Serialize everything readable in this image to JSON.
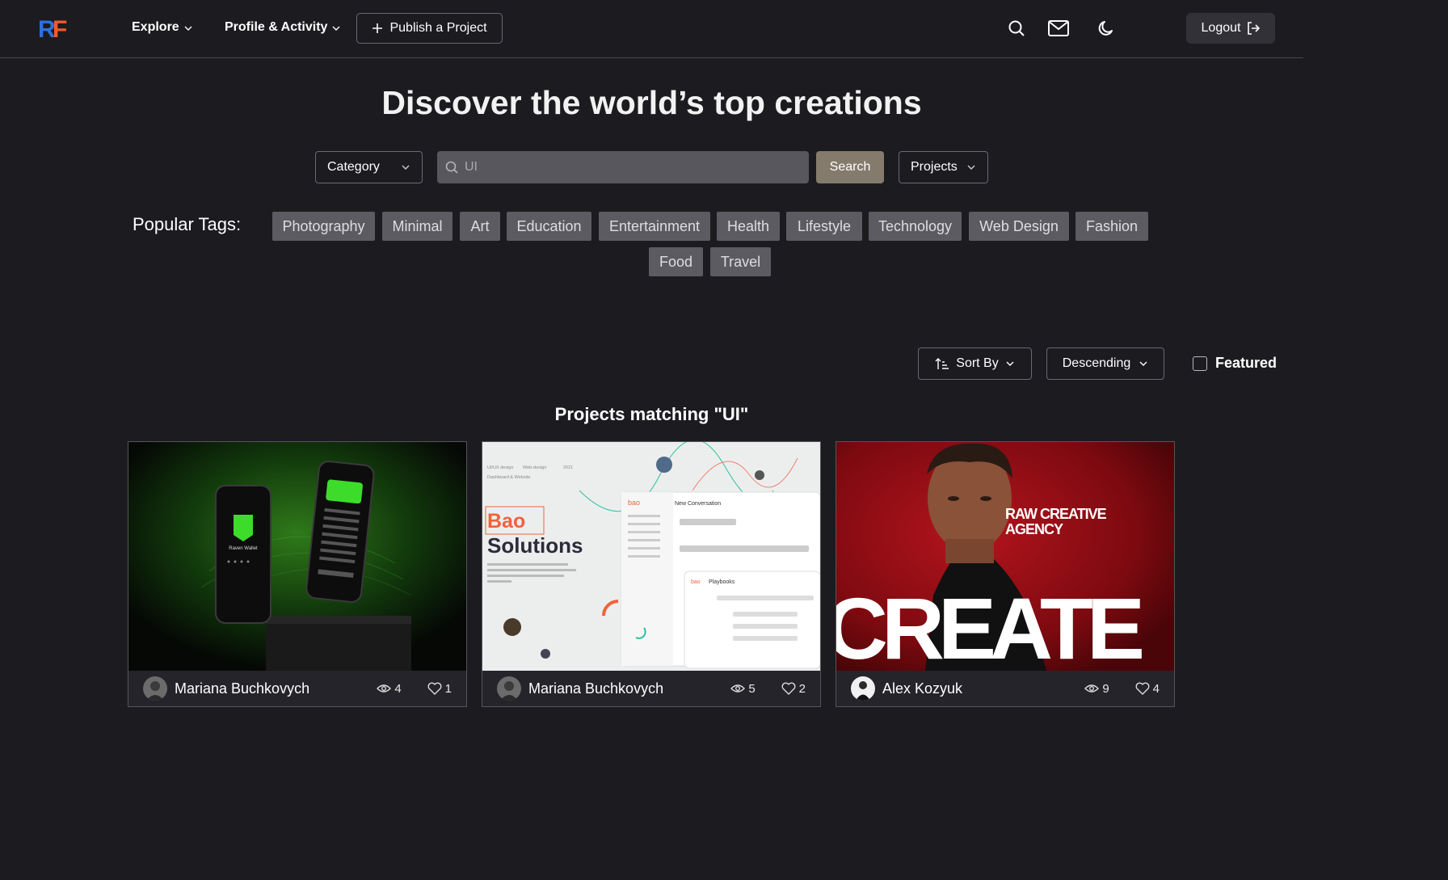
{
  "navbar": {
    "logo_text": "RF",
    "explore_label": "Explore",
    "profile_label": "Profile & Activity",
    "publish_label": "Publish a Project",
    "logout_label": "Logout"
  },
  "hero": {
    "title": "Discover the world’s top creations"
  },
  "search": {
    "category_label": "Category",
    "query": "UI",
    "button_label": "Search",
    "scope_label": "Projects"
  },
  "tags": {
    "label": "Popular Tags:",
    "items": [
      "Photography",
      "Minimal",
      "Art",
      "Education",
      "Entertainment",
      "Health",
      "Lifestyle",
      "Technology",
      "Web Design",
      "Fashion",
      "Food",
      "Travel"
    ]
  },
  "sort": {
    "sort_label": "Sort By",
    "order_label": "Descending",
    "featured_label": "Featured",
    "featured_checked": false
  },
  "results": {
    "title": "Projects matching \"UI\""
  },
  "projects": [
    {
      "author": "Mariana Buchkovych",
      "views": "4",
      "likes": "1",
      "thumb_text": [
        "Raven Wallet"
      ]
    },
    {
      "author": "Mariana Buchkovych",
      "views": "5",
      "likes": "2",
      "thumb_text": [
        "UI/UX design",
        "Web-design",
        "2021",
        "Dashboard & Website",
        "Bao",
        "Solutions",
        "New Conversation",
        "Playbooks",
        "bao"
      ]
    },
    {
      "author": "Alex Kozyuk",
      "views": "9",
      "likes": "4",
      "thumb_text": [
        "RAW CREATIVE",
        "AGENCY",
        "CREATE"
      ]
    }
  ],
  "colors": {
    "background": "#1c1b20",
    "tag_bg": "#5c5b62",
    "search_button": "#857b6d",
    "logo_blue": "#2f6fe0",
    "logo_orange": "#f25a2a"
  },
  "icons": [
    "search-icon",
    "mail-icon",
    "moon-icon",
    "logout-icon",
    "plus-icon",
    "chevron-down-icon",
    "sort-icon",
    "eye-icon",
    "heart-icon"
  ]
}
